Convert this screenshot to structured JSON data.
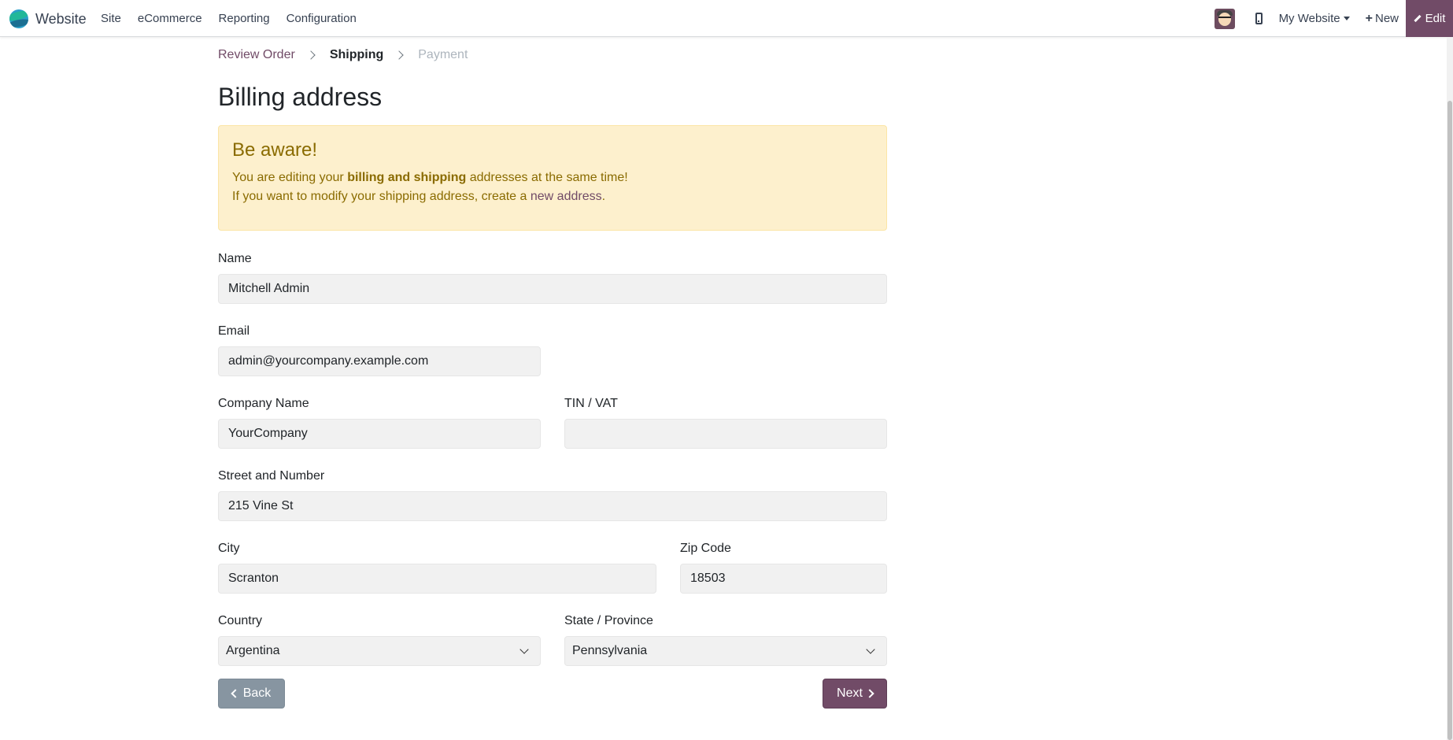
{
  "navbar": {
    "brand": "Website",
    "menu": [
      "Site",
      "eCommerce",
      "Reporting",
      "Configuration"
    ],
    "site_switcher": "My Website",
    "new_label": "New",
    "edit_label": "Edit",
    "accent_color": "#714b67"
  },
  "wizard": {
    "steps": [
      {
        "label": "Review Order",
        "state": "done"
      },
      {
        "label": "Shipping",
        "state": "active"
      },
      {
        "label": "Payment",
        "state": "todo"
      }
    ]
  },
  "page": {
    "title": "Billing address"
  },
  "alert": {
    "title": "Be aware!",
    "line1_prefix": "You are editing your ",
    "line1_bold": "billing and shipping",
    "line1_suffix": " addresses at the same time!",
    "line2_prefix": "If you want to modify your shipping address, create a ",
    "line2_link": "new address",
    "line2_suffix": "."
  },
  "form": {
    "name": {
      "label": "Name",
      "value": "Mitchell Admin"
    },
    "email": {
      "label": "Email",
      "value": "admin@yourcompany.example.com"
    },
    "company": {
      "label": "Company Name",
      "value": "YourCompany"
    },
    "vat": {
      "label": "TIN / VAT",
      "value": ""
    },
    "street": {
      "label": "Street and Number",
      "value": "215 Vine St"
    },
    "city": {
      "label": "City",
      "value": "Scranton"
    },
    "zip": {
      "label": "Zip Code",
      "value": "18503"
    },
    "country": {
      "label": "Country",
      "value": "Argentina"
    },
    "state": {
      "label": "State / Province",
      "value": "Pennsylvania"
    }
  },
  "actions": {
    "back": "Back",
    "next": "Next"
  }
}
